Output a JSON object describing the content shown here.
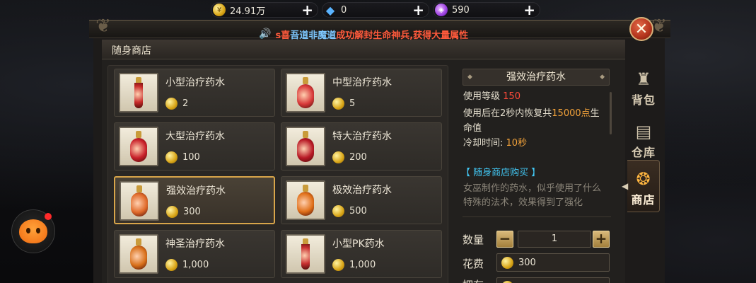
{
  "resources": [
    {
      "icon": "gold-coin-icon",
      "value": "24.91万"
    },
    {
      "icon": "diamond-icon",
      "value": "0"
    },
    {
      "icon": "crystal-icon",
      "value": "590"
    }
  ],
  "shop_notice": {
    "part1": "s喜",
    "part2": "吾道非魔道",
    "part3": "成功解封生命神兵,获得大量属性"
  },
  "panel_title": "随身商店",
  "items": [
    {
      "name": "小型治疗药水",
      "price": "2",
      "color": "#c82a2a",
      "shape": "tube"
    },
    {
      "name": "中型治疗药水",
      "price": "5",
      "color": "#d83a3a",
      "shape": "round"
    },
    {
      "name": "大型治疗药水",
      "price": "100",
      "color": "#c8202a",
      "shape": "round"
    },
    {
      "name": "特大治疗药水",
      "price": "200",
      "color": "#b81a26",
      "shape": "round"
    },
    {
      "name": "强效治疗药水",
      "price": "300",
      "color": "#e06a2a",
      "shape": "round",
      "selected": true
    },
    {
      "name": "极效治疗药水",
      "price": "500",
      "color": "#e0701a",
      "shape": "round"
    },
    {
      "name": "神圣治疗药水",
      "price": "1,000",
      "color": "#d8701a",
      "shape": "round"
    },
    {
      "name": "小型PK药水",
      "price": "1,000",
      "color": "#c83030",
      "shape": "tube"
    }
  ],
  "detail": {
    "title": "强效治疗药水",
    "level_label": "使用等级",
    "level_value": "150",
    "effect_pre": "使用后在2秒内恢复共",
    "effect_value": "15000点",
    "effect_post": "生",
    "effect_line2": "命值",
    "cooldown_label": "冷却时间:",
    "cooldown_value": "10秒",
    "source": "【 随身商店购买 】",
    "desc_line1": "女巫制作的药水，似乎使用了什么",
    "desc_line2": "特殊的法术，效果得到了强化",
    "qty_label": "数量",
    "qty_minus": "−",
    "qty_value": "1",
    "qty_plus": "+",
    "cost_label": "花费",
    "cost_value": "300",
    "stock_label": "拥有"
  },
  "tabs": [
    {
      "label": "背包",
      "icon": "backpack-icon"
    },
    {
      "label": "仓库",
      "icon": "warehouse-icon"
    },
    {
      "label": "商店",
      "icon": "shop-icon"
    }
  ]
}
